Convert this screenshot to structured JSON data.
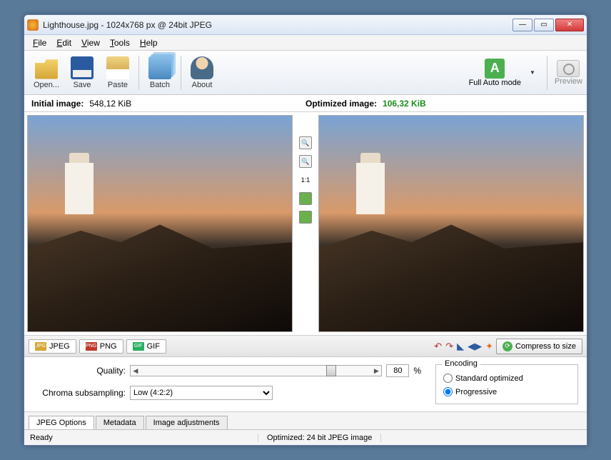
{
  "window": {
    "title": "Lighthouse.jpg - 1024x768 px @ 24bit JPEG"
  },
  "menu": {
    "file": "File",
    "edit": "Edit",
    "view": "View",
    "tools": "Tools",
    "help": "Help"
  },
  "toolbar": {
    "open": "Open...",
    "save": "Save",
    "paste": "Paste",
    "batch": "Batch",
    "about": "About",
    "fullauto": "Full Auto mode",
    "preview": "Preview"
  },
  "sizes": {
    "initial_label": "Initial image:",
    "initial_value": "548,12 KiB",
    "optimized_label": "Optimized image:",
    "optimized_value": "106,32 KiB"
  },
  "midtools": {
    "ratio": "1:1"
  },
  "format_tabs": {
    "jpeg": "JPEG",
    "png": "PNG",
    "gif": "GIF"
  },
  "compress_btn": "Compress to size",
  "options": {
    "quality_label": "Quality:",
    "quality_value": "80",
    "percent": "%",
    "chroma_label": "Chroma subsampling:",
    "chroma_value": "Low (4:2:2)",
    "encoding_legend": "Encoding",
    "standard": "Standard optimized",
    "progressive": "Progressive"
  },
  "bottom_tabs": {
    "jpeg_options": "JPEG Options",
    "metadata": "Metadata",
    "image_adjustments": "Image adjustments"
  },
  "status": {
    "ready": "Ready",
    "optimized": "Optimized: 24 bit JPEG image"
  }
}
